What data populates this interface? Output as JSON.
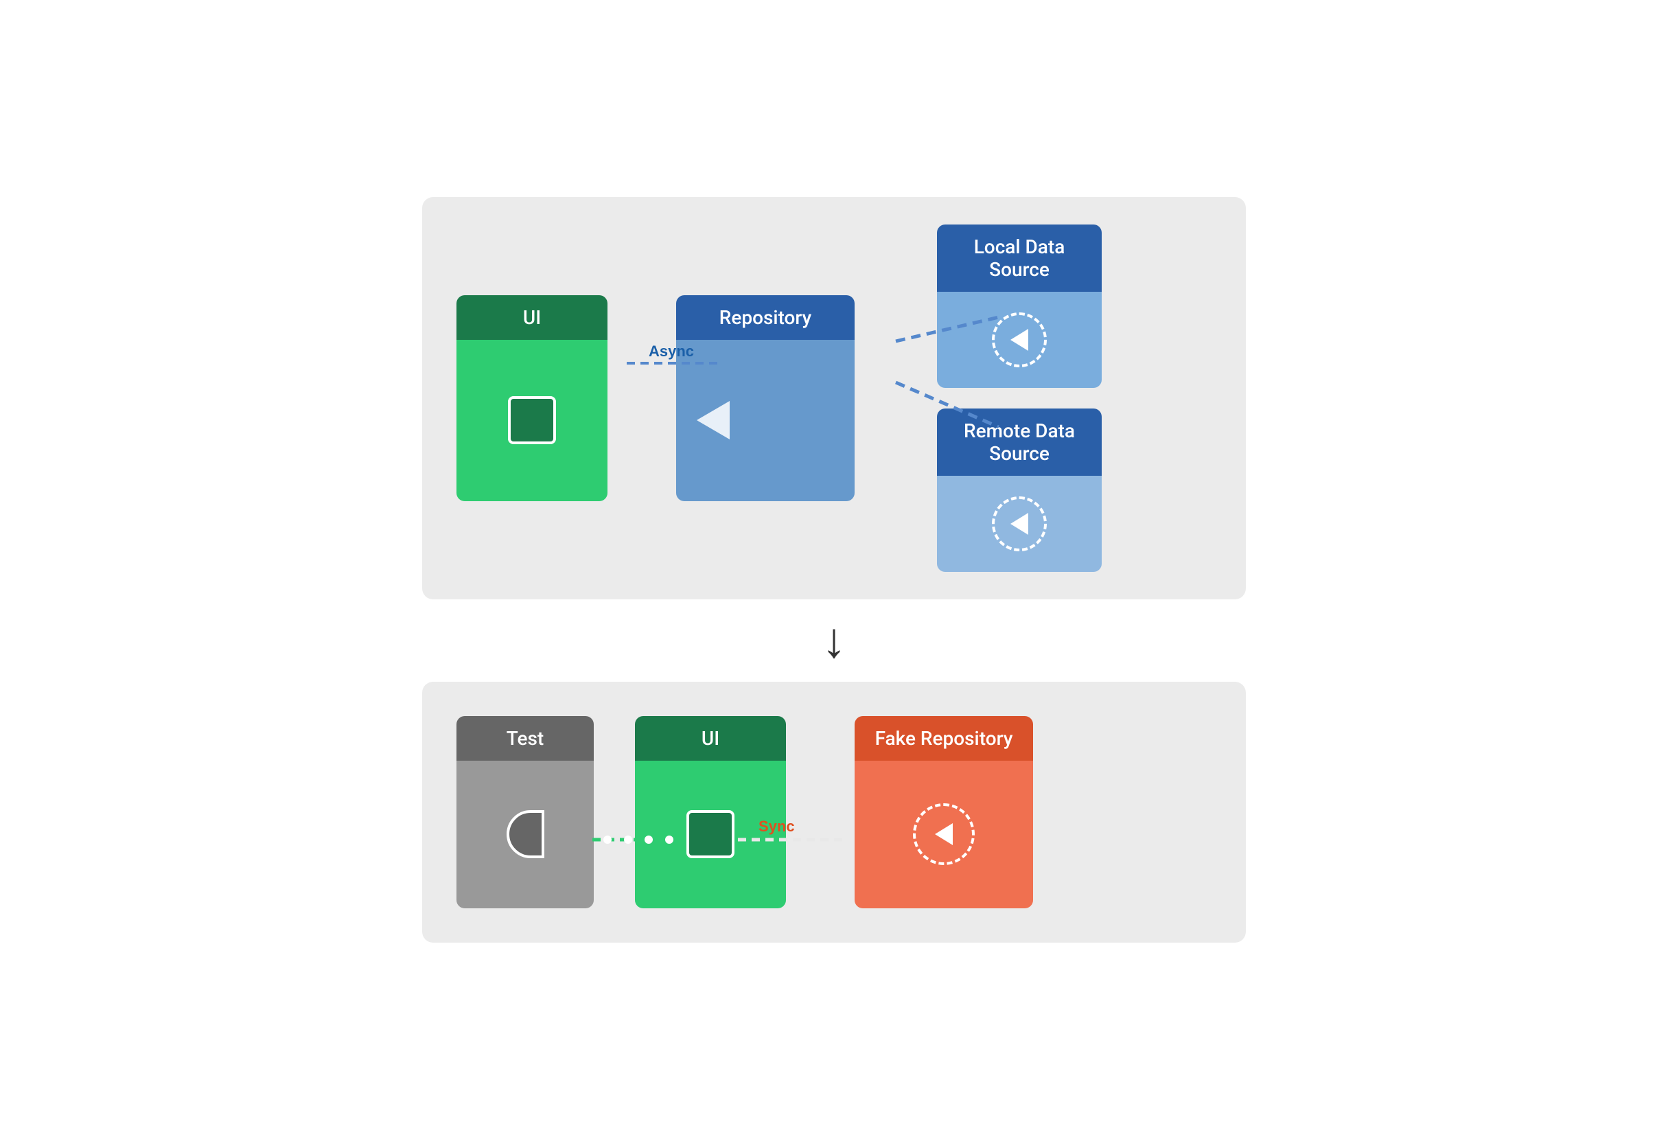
{
  "top_diagram": {
    "ui_label": "UI",
    "repo_label": "Repository",
    "local_ds_label": "Local Data Source",
    "remote_ds_label": "Remote Data Source",
    "async_label": "Async",
    "bg_color": "#ebebeb"
  },
  "arrow_down": "↓",
  "bottom_diagram": {
    "test_label": "Test",
    "ui_label": "UI",
    "fake_repo_label": "Fake Repository",
    "sync_label": "Sync",
    "bg_color": "#ebebeb"
  }
}
